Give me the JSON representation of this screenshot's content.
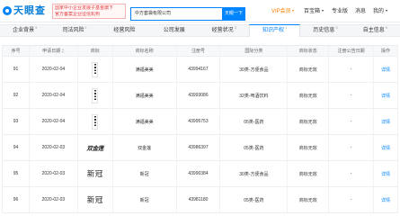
{
  "header": {
    "logo_text": "天眼查",
    "badge": [
      "国家中小企业发展子基金旗下",
      "官方备案企业征信机构"
    ],
    "search_value": "中方套袋有限公司",
    "search_button": "天眼一下",
    "nav": {
      "vip": "VIP会员",
      "toolbox": "百宝箱",
      "pro": "专业版",
      "messages": "消息",
      "user": "我的"
    }
  },
  "tabs": [
    {
      "label": "企业背景",
      "count": "9"
    },
    {
      "label": "司法风险",
      "count": "1"
    },
    {
      "label": "经营风险"
    },
    {
      "label": "公司发展"
    },
    {
      "label": "经营状况",
      "count": "3"
    },
    {
      "label": "知识产权",
      "count": "1",
      "active": true
    },
    {
      "label": "历史信息",
      "count": "3"
    },
    {
      "label": "自主信息",
      "count": "9"
    }
  ],
  "table": {
    "columns": {
      "index": "序号",
      "apply_date": "申请日期",
      "mark": "商标",
      "name": "商标名称",
      "reg_no": "注册号",
      "class": "国际分类",
      "status": "商标状态",
      "notice_date": "注册公告日期",
      "action": "操作"
    },
    "rows": [
      {
        "no": "91",
        "apply_date": "2020-02-04",
        "name": "满福美美",
        "reg_no": "43994167",
        "class": "30类-方便食品",
        "status": "商标无效",
        "notice_date": "-",
        "action": "详情"
      },
      {
        "no": "92",
        "apply_date": "2020-02-04",
        "name": "满福美美",
        "reg_no": "43993086",
        "class": "32类-啤酒饮料",
        "status": "商标无效",
        "notice_date": "-",
        "action": "详情"
      },
      {
        "no": "93",
        "apply_date": "2020-02-04",
        "name": "满福美美",
        "reg_no": "43995753",
        "class": "05类-医药",
        "status": "商标无效",
        "notice_date": "-",
        "action": "详情"
      },
      {
        "no": "94",
        "apply_date": "2020-02-03",
        "mark_text": "双金莲",
        "name": "双金莲",
        "reg_no": "43986397",
        "class": "05类-医药",
        "status": "商标无效",
        "notice_date": "-",
        "action": "详情"
      },
      {
        "no": "95",
        "apply_date": "2020-02-03",
        "mark_text": "新冠",
        "name": "新冠",
        "reg_no": "43990384",
        "class": "30类-方便食品",
        "status": "商标无效",
        "notice_date": "-",
        "action": "详情"
      },
      {
        "no": "96",
        "apply_date": "2020-02-03",
        "mark_text": "新冠",
        "name": "新冠",
        "reg_no": "43981180",
        "class": "05类-医药",
        "status": "商标无效",
        "notice_date": "-",
        "action": "详情"
      }
    ]
  },
  "colors": {
    "brand": "#0084ff",
    "vip": "#ff7e00",
    "badge_red": "#e4393c",
    "link": "#0084ff"
  },
  "icons": {
    "logo": "tianyancha-logo-icon",
    "dropdown": "chevron-down-icon",
    "sort": "sort-icon",
    "trademark_image": "trademark-image"
  }
}
